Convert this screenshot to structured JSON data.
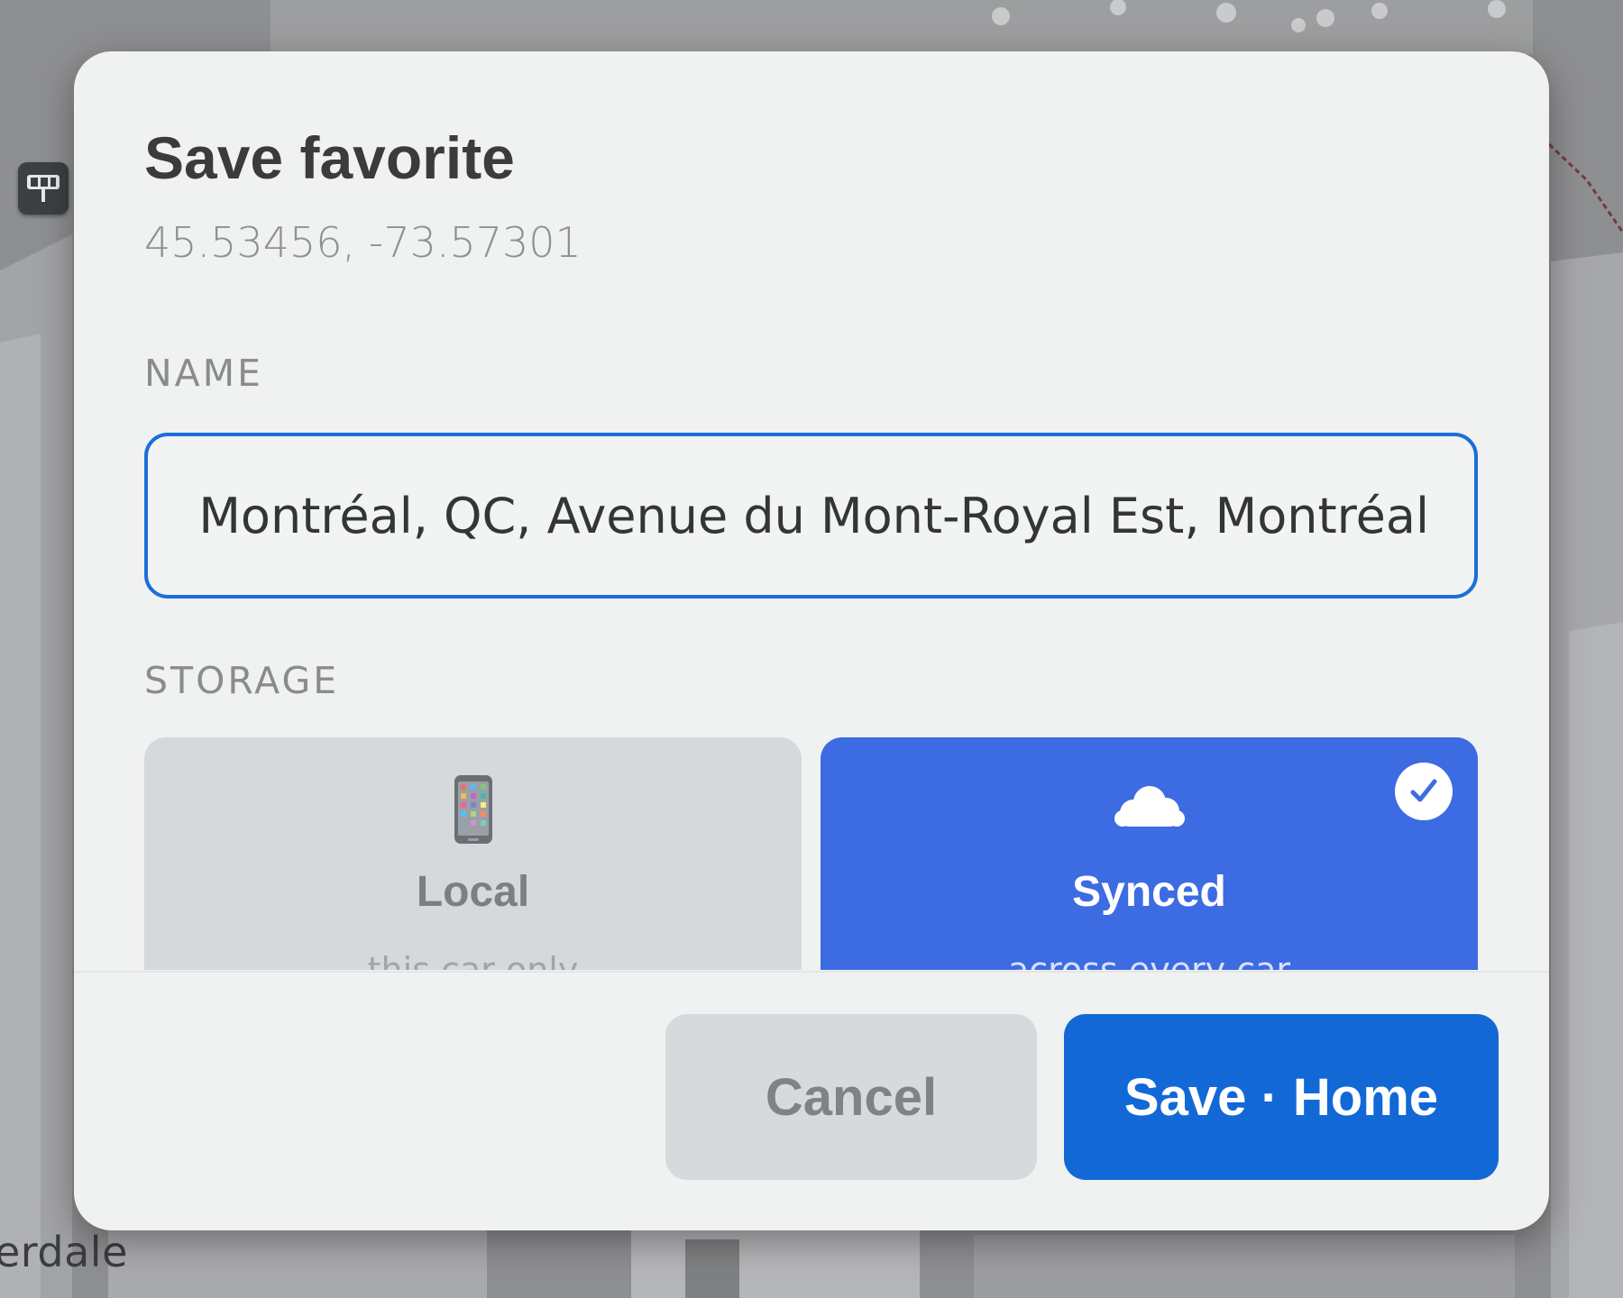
{
  "map": {
    "place_label": "erdale"
  },
  "dialog": {
    "title": "Save favorite",
    "coordinates": "45.53456, -73.57301",
    "name_label": "NAME",
    "name_value": "E, Montréal, QC, Avenue du Mont-Royal Est, Montréal",
    "storage_label": "STORAGE",
    "storage_options": [
      {
        "icon": "phone-icon",
        "title": "Local",
        "subtitle": "this car only",
        "selected": false
      },
      {
        "icon": "cloud-icon",
        "title": "Synced",
        "subtitle": "across every car",
        "selected": true
      }
    ],
    "cancel_label": "Cancel",
    "save_label": "Save · Home"
  },
  "colors": {
    "accent": "#1269d6",
    "selected_card": "#3d6be2",
    "input_border": "#1a6fd8"
  }
}
